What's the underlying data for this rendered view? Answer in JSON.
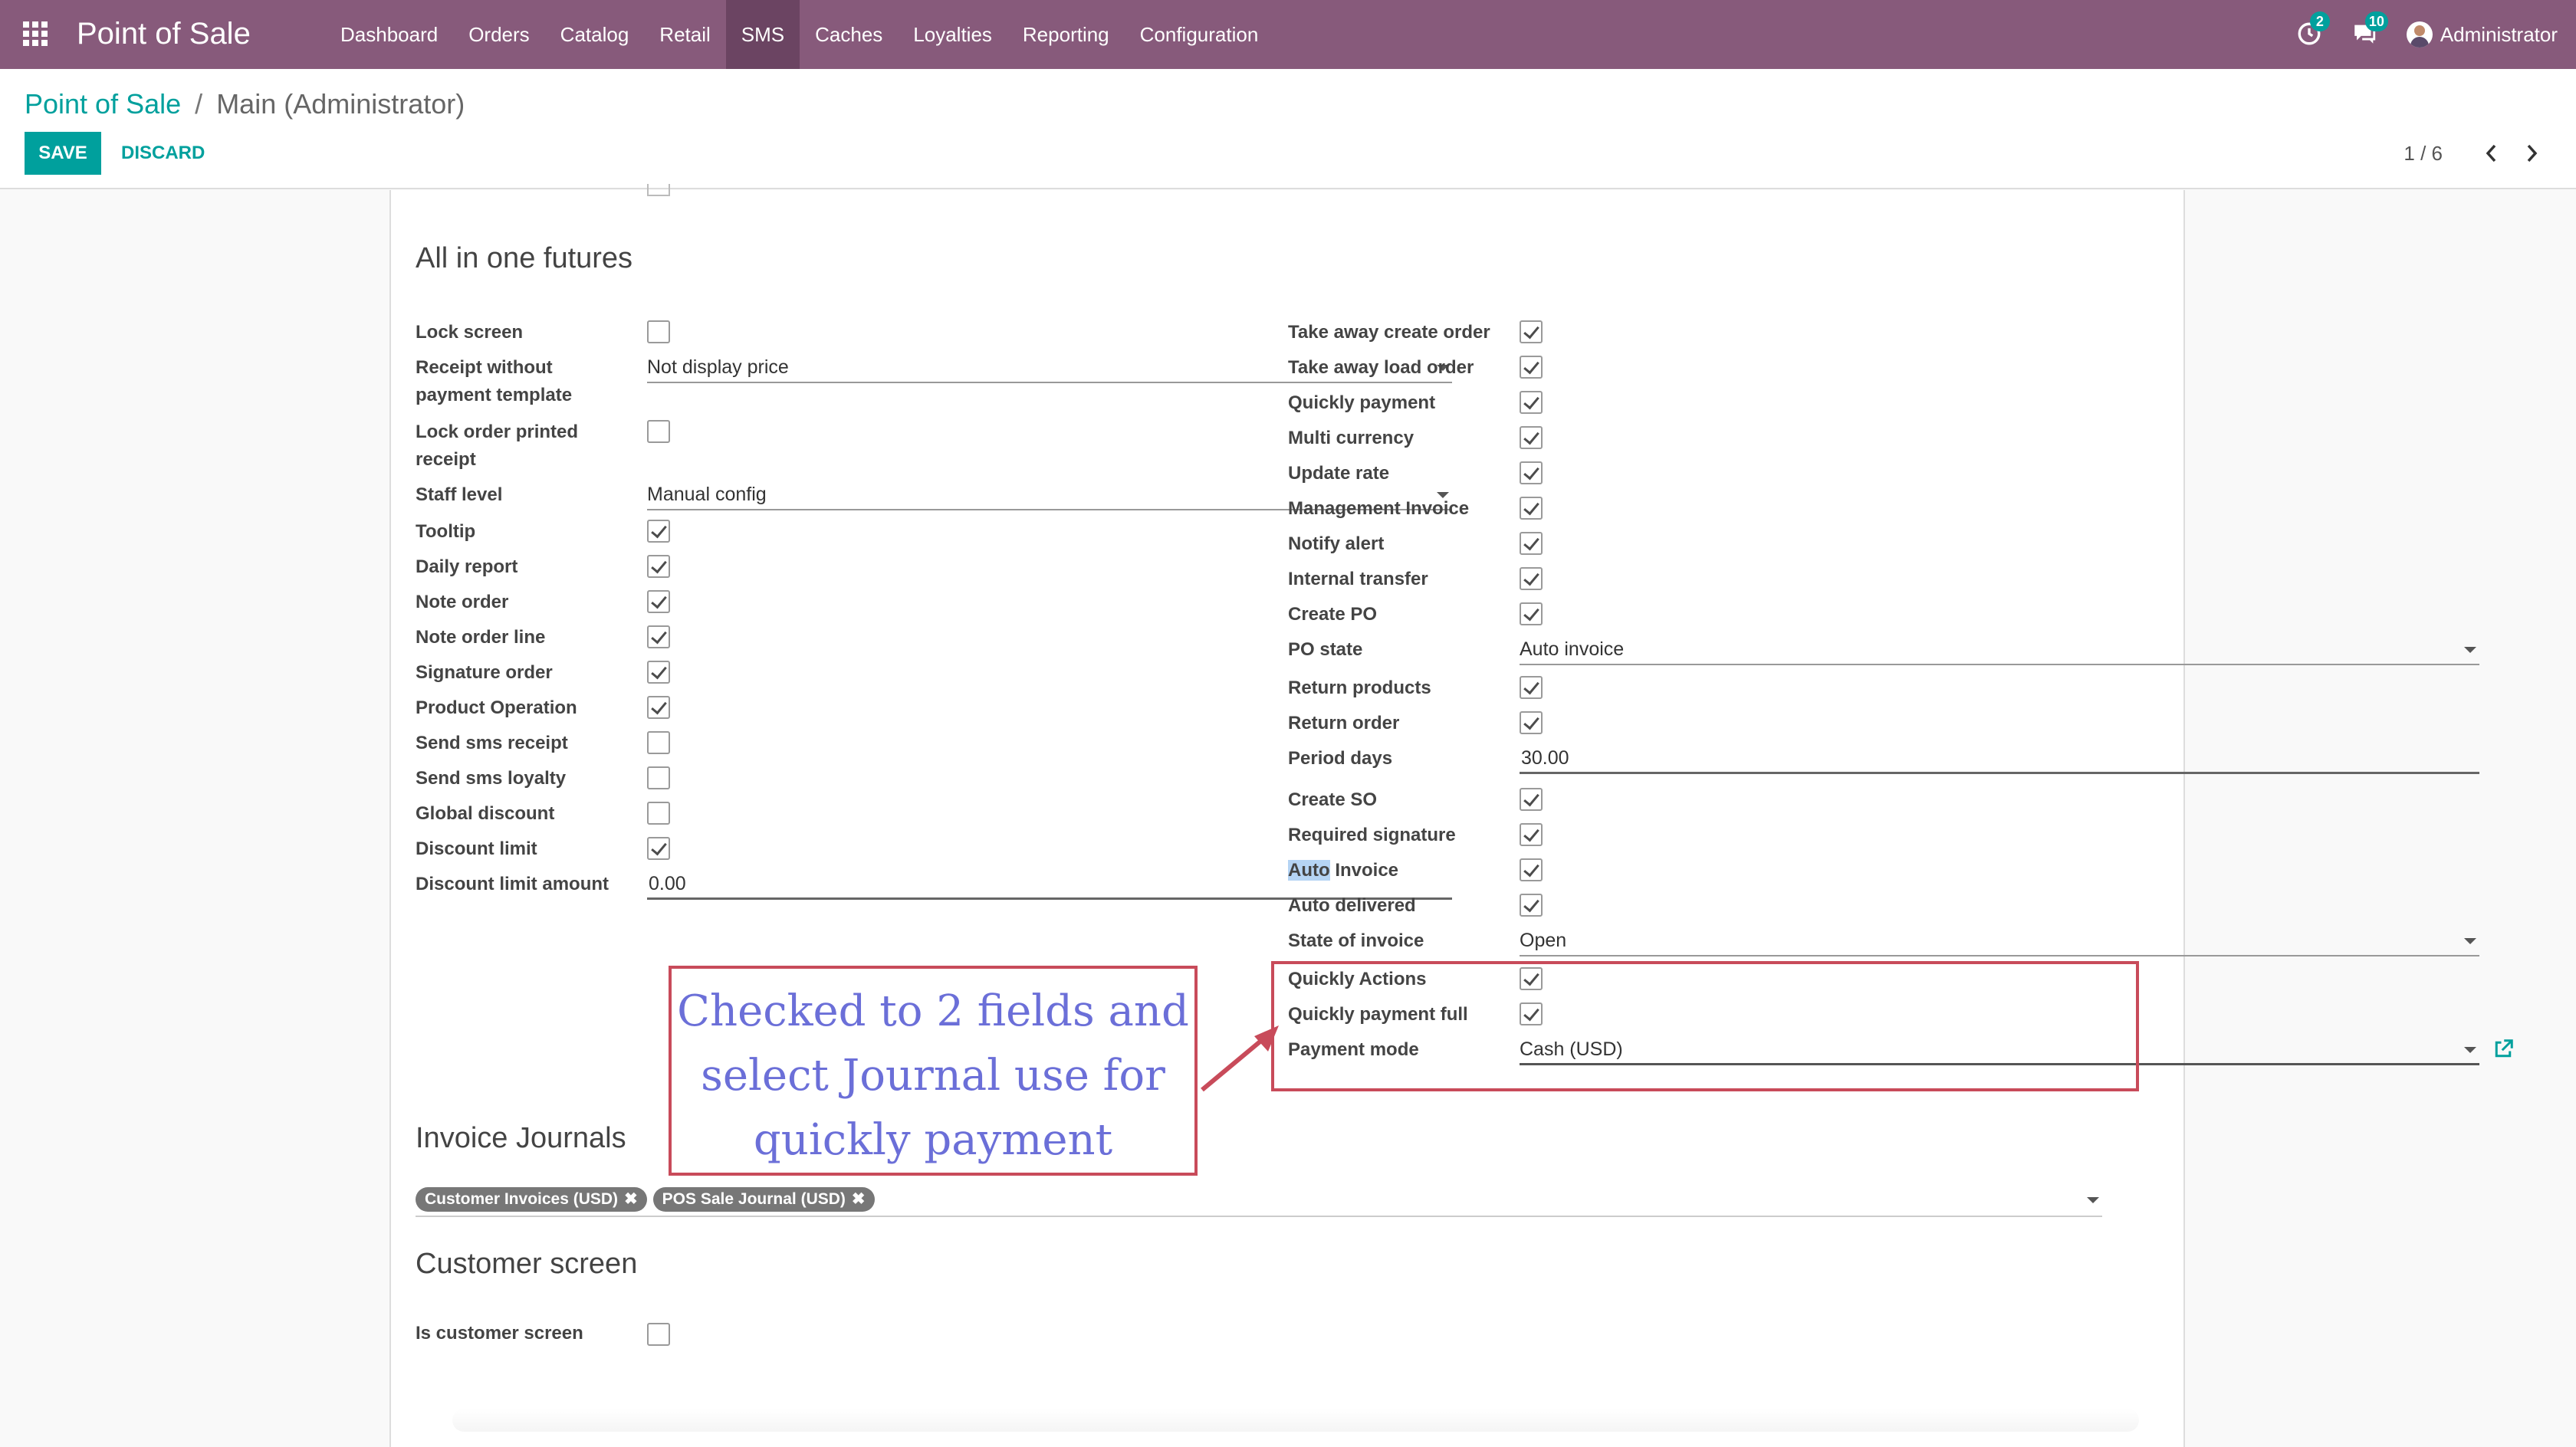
{
  "navbar": {
    "app_title": "Point of Sale",
    "menu": [
      "Dashboard",
      "Orders",
      "Catalog",
      "Retail",
      "SMS",
      "Caches",
      "Loyalties",
      "Reporting",
      "Configuration"
    ],
    "active_menu": "SMS",
    "activity_badge": "2",
    "messages_badge": "10",
    "user": "Administrator",
    "accent_color": "#875a7b"
  },
  "control_panel": {
    "breadcrumb_root": "Point of Sale",
    "breadcrumb_separator": "/",
    "breadcrumb_current": "Main (Administrator)",
    "save_label": "SAVE",
    "discard_label": "DISCARD",
    "pager": "1 / 6",
    "button_color": "#00a09d"
  },
  "form": {
    "section_all_in_one": "All in one futures",
    "left_fields": [
      {
        "label": "Lock screen",
        "type": "checkbox",
        "checked": false
      },
      {
        "label": "Receipt without payment template",
        "type": "select",
        "value": "Not display price"
      },
      {
        "label": "Lock order printed receipt",
        "type": "checkbox",
        "checked": false
      },
      {
        "label": "Staff level",
        "type": "select",
        "value": "Manual config"
      },
      {
        "label": "Tooltip",
        "type": "checkbox",
        "checked": true
      },
      {
        "label": "Daily report",
        "type": "checkbox",
        "checked": true
      },
      {
        "label": "Note order",
        "type": "checkbox",
        "checked": true
      },
      {
        "label": "Note order line",
        "type": "checkbox",
        "checked": true
      },
      {
        "label": "Signature order",
        "type": "checkbox",
        "checked": true
      },
      {
        "label": "Product Operation",
        "type": "checkbox",
        "checked": true
      },
      {
        "label": "Send sms receipt",
        "type": "checkbox",
        "checked": false
      },
      {
        "label": "Send sms loyalty",
        "type": "checkbox",
        "checked": false
      },
      {
        "label": "Global discount",
        "type": "checkbox",
        "checked": false
      },
      {
        "label": "Discount limit",
        "type": "checkbox",
        "checked": true
      },
      {
        "label": "Discount limit amount",
        "type": "input",
        "value": "0.00"
      }
    ],
    "right_fields": [
      {
        "label": "Take away create order",
        "type": "checkbox",
        "checked": true
      },
      {
        "label": "Take away load order",
        "type": "checkbox",
        "checked": true
      },
      {
        "label": "Quickly payment",
        "type": "checkbox",
        "checked": true
      },
      {
        "label": "Multi currency",
        "type": "checkbox",
        "checked": true
      },
      {
        "label": "Update rate",
        "type": "checkbox",
        "checked": true
      },
      {
        "label": "Management Invoice",
        "type": "checkbox",
        "checked": true
      },
      {
        "label": "Notify alert",
        "type": "checkbox",
        "checked": true
      },
      {
        "label": "Internal transfer",
        "type": "checkbox",
        "checked": true
      },
      {
        "label": "Create PO",
        "type": "checkbox",
        "checked": true
      },
      {
        "label": "PO state",
        "type": "select",
        "value": "Auto invoice"
      },
      {
        "label": "Return products",
        "type": "checkbox",
        "checked": true
      },
      {
        "label": "Return order",
        "type": "checkbox",
        "checked": true
      },
      {
        "label": "Period days",
        "type": "input",
        "value": "30.00"
      },
      {
        "label": "Create SO",
        "type": "checkbox",
        "checked": true
      },
      {
        "label": "Required signature",
        "type": "checkbox",
        "checked": true
      },
      {
        "label": "Auto Invoice",
        "type": "checkbox",
        "checked": true
      },
      {
        "label": "Auto delivered",
        "type": "checkbox",
        "checked": true
      },
      {
        "label": "State of invoice",
        "type": "select",
        "value": "Open"
      },
      {
        "label": "Quickly Actions",
        "type": "checkbox",
        "checked": true
      },
      {
        "label": "Quickly payment full",
        "type": "checkbox",
        "checked": true
      },
      {
        "label": "Payment mode",
        "type": "select",
        "value": "Cash (USD)"
      }
    ],
    "auto_invoice_highlight": "Auto",
    "auto_invoice_rest": " Invoice",
    "section_invoice_journals": "Invoice Journals",
    "invoice_journal_tags": [
      "Customer Invoices (USD)",
      "POS Sale Journal (USD)"
    ],
    "section_customer_screen": "Customer screen",
    "is_customer_screen_label": "Is customer screen",
    "is_customer_screen_checked": false
  },
  "annotation": {
    "note_lines": [
      "Checked to 2 fields and",
      "select Journal use for",
      "quickly payment"
    ],
    "color": "#c84b5a",
    "text_color": "#6b6fd8"
  },
  "icons": {
    "apps": "apps-grid-icon",
    "activity": "clock-icon",
    "messages": "chat-icon",
    "pager_prev": "chevron-left-icon",
    "pager_next": "chevron-right-icon",
    "external": "external-link-icon",
    "tag_remove": "close-icon"
  }
}
